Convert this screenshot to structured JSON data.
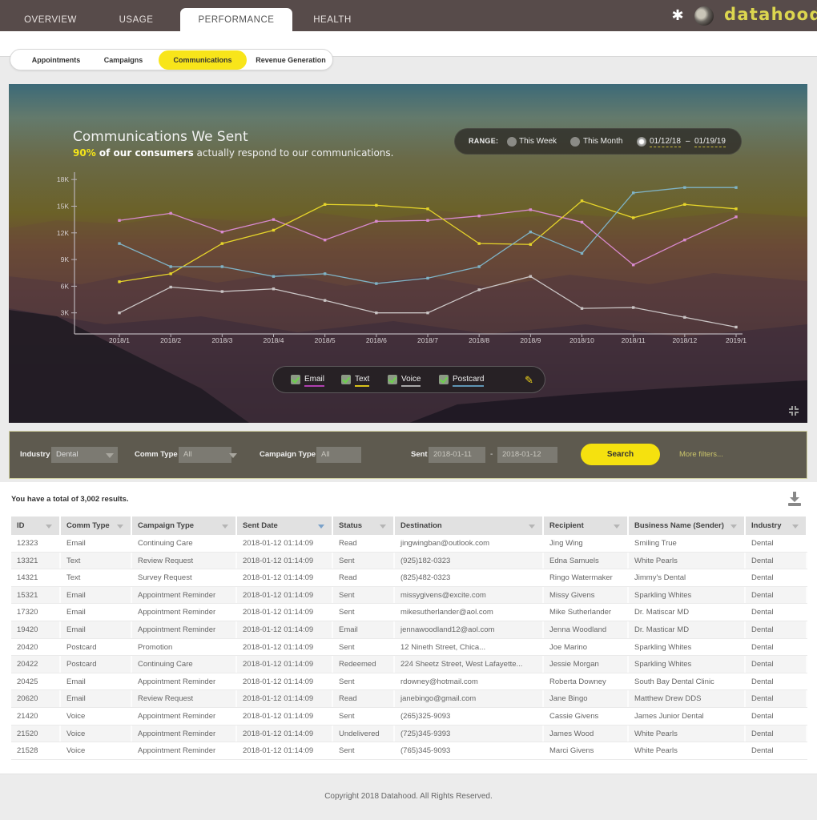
{
  "brand": {
    "name": "datahood",
    "color": "#dcd64f"
  },
  "nav": {
    "tabs": [
      {
        "label": "OVERVIEW"
      },
      {
        "label": "USAGE"
      },
      {
        "label": "PERFORMANCE",
        "active": true
      },
      {
        "label": "HEALTH"
      }
    ],
    "settings_icon": "gear-icon",
    "avatar_icon": "user-avatar"
  },
  "subnav": {
    "tabs": [
      {
        "label": "Appointments"
      },
      {
        "label": "Campaigns"
      },
      {
        "label": "Communications",
        "active": true
      },
      {
        "label": "Revenue Generation"
      }
    ],
    "accent": "#f8e51a"
  },
  "hero": {
    "title": "Communications We Sent",
    "subtitle_pct": "90%",
    "subtitle_bold": " of our consumers",
    "subtitle_rest": " actually respond to our communications.",
    "range": {
      "label": "RANGE:",
      "options": [
        "This Week",
        "This Month"
      ],
      "selected": "custom",
      "date_from": "01/12/18",
      "date_sep": "–",
      "date_to": "01/19/19"
    },
    "legend_edit_icon": "pencil-icon",
    "collapse_icon": "collapse-icon"
  },
  "chart_data": {
    "type": "line",
    "title": "Communications We Sent",
    "xlabel": "",
    "ylabel": "",
    "x": [
      "2018/1",
      "2018/2",
      "2018/3",
      "2018/4",
      "2018/5",
      "2018/6",
      "2018/7",
      "2018/8",
      "2018/9",
      "2018/10",
      "2018/11",
      "2018/12",
      "2019/1"
    ],
    "yticks": [
      "3K",
      "6K",
      "9K",
      "12K",
      "15K",
      "18K"
    ],
    "ytick_values": [
      3000,
      6000,
      9000,
      12000,
      15000,
      18000
    ],
    "ylim": [
      0,
      18500
    ],
    "grid": false,
    "legend_position": "bottom-center",
    "series": [
      {
        "name": "Email",
        "color": "#d98ad0",
        "checked": true,
        "values": [
          13400,
          14200,
          12100,
          13500,
          11200,
          13300,
          13400,
          13900,
          14600,
          13200,
          8400,
          11200,
          13800
        ]
      },
      {
        "name": "Text",
        "color": "#e6d52a",
        "checked": true,
        "values": [
          6500,
          7400,
          10800,
          12300,
          15200,
          15100,
          14700,
          10800,
          10700,
          15600,
          13700,
          15200,
          14700
        ]
      },
      {
        "name": "Voice",
        "color": "#c9c4c4",
        "checked": true,
        "values": [
          3000,
          5900,
          5400,
          5700,
          4400,
          3000,
          3000,
          5600,
          7100,
          3500,
          3600,
          2500,
          1400
        ]
      },
      {
        "name": "Postcard",
        "color": "#7fb3c6",
        "checked": true,
        "values": [
          10800,
          8200,
          8200,
          7100,
          7400,
          6300,
          6900,
          8200,
          12100,
          9700,
          16500,
          17100,
          17100
        ]
      }
    ]
  },
  "filters": {
    "industry": {
      "label": "Industry",
      "value": "Dental"
    },
    "comm_type": {
      "label": "Comm Type",
      "value": "All"
    },
    "campaign_type": {
      "label": "Campaign Type",
      "value": "All"
    },
    "sent": {
      "label": "Sent",
      "from": "2018-01-11",
      "sep": "-",
      "to": "2018-01-12"
    },
    "search_label": "Search",
    "more_filters_label": "More filters..."
  },
  "results": {
    "summary": "You have a total of 3,002 results.",
    "download_icon": "download-icon",
    "columns": [
      "ID",
      "Comm Type",
      "Campaign Type",
      "Sent Date",
      "Status",
      "Destination",
      "Recipient",
      "Business Name (Sender)",
      "Industry"
    ],
    "sorted_column": "Sent Date",
    "rows": [
      [
        "12323",
        "Email",
        "Continuing Care",
        "2018-01-12 01:14:09",
        "Read",
        "jingwingban@outlook.com",
        "Jing Wing",
        "Smiling True",
        "Dental"
      ],
      [
        "13321",
        "Text",
        "Review Request",
        "2018-01-12 01:14:09",
        "Sent",
        "(925)182-0323",
        "Edna Samuels",
        "White Pearls",
        "Dental"
      ],
      [
        "14321",
        "Text",
        "Survey Request",
        "2018-01-12 01:14:09",
        "Read",
        "(825)482-0323",
        "Ringo Watermaker",
        "Jimmy's Dental",
        "Dental"
      ],
      [
        "15321",
        "Email",
        "Appointment Reminder",
        "2018-01-12 01:14:09",
        "Sent",
        "missygivens@excite.com",
        "Missy Givens",
        "Sparkling Whites",
        "Dental"
      ],
      [
        "17320",
        "Email",
        "Appointment Reminder",
        "2018-01-12 01:14:09",
        "Sent",
        "mikesutherlander@aol.com",
        "Mike Sutherlander",
        "Dr. Matiscar MD",
        "Dental"
      ],
      [
        "19420",
        "Email",
        "Appointment Reminder",
        "2018-01-12 01:14:09",
        "Email",
        "jennawoodland12@aol.com",
        "Jenna Woodland",
        "Dr. Masticar MD",
        "Dental"
      ],
      [
        "20420",
        "Postcard",
        "Promotion",
        "2018-01-12 01:14:09",
        "Sent",
        "12 Nineth Street, Chica...",
        "Joe Marino",
        "Sparkling Whites",
        "Dental"
      ],
      [
        "20422",
        "Postcard",
        "Continuing Care",
        "2018-01-12 01:14:09",
        "Redeemed",
        "224 Sheetz Street, West Lafayette...",
        "Jessie Morgan",
        "Sparkling Whites",
        "Dental"
      ],
      [
        "20425",
        "Email",
        "Appointment Reminder",
        "2018-01-12 01:14:09",
        "Sent",
        "rdowney@hotmail.com",
        "Roberta Downey",
        "South Bay Dental Clinic",
        "Dental"
      ],
      [
        "20620",
        "Email",
        "Review Request",
        "2018-01-12 01:14:09",
        "Read",
        "janebingo@gmail.com",
        "Jane Bingo",
        "Matthew Drew DDS",
        "Dental"
      ],
      [
        "21420",
        "Voice",
        "Appointment Reminder",
        "2018-01-12 01:14:09",
        "Sent",
        "(265)325-9093",
        "Cassie Givens",
        "James Junior Dental",
        "Dental"
      ],
      [
        "21520",
        "Voice",
        "Appointment Reminder",
        "2018-01-12 01:14:09",
        "Undelivered",
        "(725)345-9393",
        "James Wood",
        "White Pearls",
        "Dental"
      ],
      [
        "21528",
        "Voice",
        "Appointment Reminder",
        "2018-01-12 01:14:09",
        "Sent",
        "(765)345-9093",
        "Marci Givens",
        "White Pearls",
        "Dental"
      ]
    ]
  },
  "footer": {
    "copyright": "Copyright 2018 Datahood. All Rights Reserved."
  }
}
